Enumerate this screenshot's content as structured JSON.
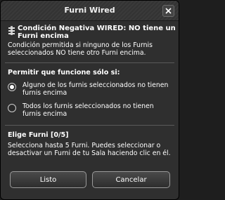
{
  "window": {
    "title": "Furni Wired",
    "close_icon": "close-x-icon"
  },
  "header": {
    "icon": "wired-condition-icon",
    "title": "Condición Negativa WIRED: NO tiene un Furni encima",
    "description": "Condición permitida si ninguno de los Furnis seleccionados NO tiene otro Furni encima."
  },
  "options": {
    "label": "Permitir que funcione sólo si:",
    "items": [
      {
        "label": "Alguno de los furnis seleccionados no tienen furnis encima",
        "selected": true
      },
      {
        "label": "Todos los furnis seleccionados no tienen furnis encima",
        "selected": false
      }
    ]
  },
  "furni_select": {
    "label": "Elige Furni [0/5]",
    "info": "Selecciona hasta 5 Furni. Puedes seleccionar o desactivar un Furni de tu Sala haciendo clic en él."
  },
  "buttons": {
    "ok_label": "Listo",
    "cancel_label": "Cancelar"
  },
  "colors": {
    "window_bg": "#2f2f2f",
    "text": "#ffffff",
    "divider": "#5a5a5a"
  }
}
